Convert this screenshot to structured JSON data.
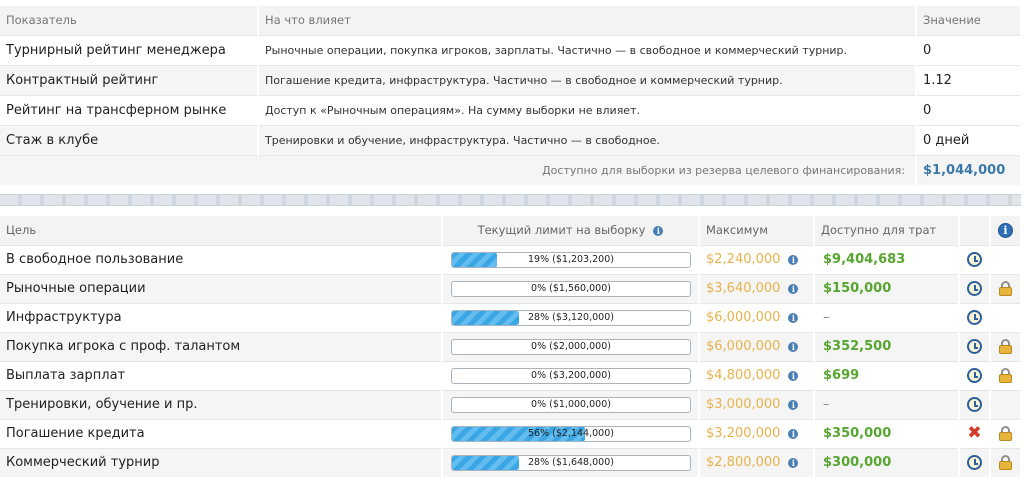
{
  "ratings": {
    "headers": {
      "indicator": "Показатель",
      "affects": "На что влияет",
      "value": "Значение"
    },
    "rows": [
      {
        "name": "Турнирный рейтинг менеджера",
        "affects": "Рыночные операции, покупка игроков, зарплаты. Частично — в свободное и коммерческий турнир.",
        "value": "0"
      },
      {
        "name": "Контрактный рейтинг",
        "affects": "Погашение кредита, инфраструктура. Частично — в свободное и коммерческий турнир.",
        "value": "1.12"
      },
      {
        "name": "Рейтинг на трансферном рынке",
        "affects": "Доступ к «Рыночным операциям». На сумму выборки не влияет.",
        "value": "0"
      },
      {
        "name": "Стаж в клубе",
        "affects": "Тренировки и обучение, инфраструктура. Частично — в свободное.",
        "value": "0 дней"
      }
    ],
    "footer": {
      "label": "Доступно для выборки из резерва целевого финансирования:",
      "value": "$1,044,000"
    }
  },
  "goals": {
    "headers": {
      "goal": "Цель",
      "limit": "Текущий лимит на выборку",
      "max": "Максимум",
      "available": "Доступно для трат"
    },
    "rows": [
      {
        "name": "В свободное пользование",
        "percent": 19,
        "limit": "19% ($1,203,200)",
        "max": "$2,240,000",
        "available": "$9,404,683",
        "action": "clock",
        "locked": false
      },
      {
        "name": "Рыночные операции",
        "percent": 0,
        "limit": "0% ($1,560,000)",
        "max": "$3,640,000",
        "available": "$150,000",
        "action": "clock",
        "locked": true
      },
      {
        "name": "Инфраструктура",
        "percent": 28,
        "limit": "28% ($3,120,000)",
        "max": "$6,000,000",
        "available": "–",
        "action": "clock",
        "locked": false
      },
      {
        "name": "Покупка игрока с проф. талантом",
        "percent": 0,
        "limit": "0% ($2,000,000)",
        "max": "$6,000,000",
        "available": "$352,500",
        "action": "clock",
        "locked": true
      },
      {
        "name": "Выплата зарплат",
        "percent": 0,
        "limit": "0% ($3,200,000)",
        "max": "$4,800,000",
        "available": "$699",
        "action": "clock",
        "locked": true
      },
      {
        "name": "Тренировки, обучение и пр.",
        "percent": 0,
        "limit": "0% ($1,000,000)",
        "max": "$3,000,000",
        "available": "–",
        "action": "clock",
        "locked": false
      },
      {
        "name": "Погашение кредита",
        "percent": 56,
        "limit": "56% ($2,144,000)",
        "max": "$3,200,000",
        "available": "$350,000",
        "action": "cancel",
        "locked": true
      },
      {
        "name": "Коммерческий турнир",
        "percent": 28,
        "limit": "28% ($1,648,000)",
        "max": "$2,800,000",
        "available": "$300,000",
        "action": "clock",
        "locked": true
      }
    ]
  },
  "colors": {
    "accent_blue": "#3a78a8",
    "money_green": "#56a630",
    "max_orange": "#e8b14a",
    "bar_blue": "#3aa6e4"
  }
}
